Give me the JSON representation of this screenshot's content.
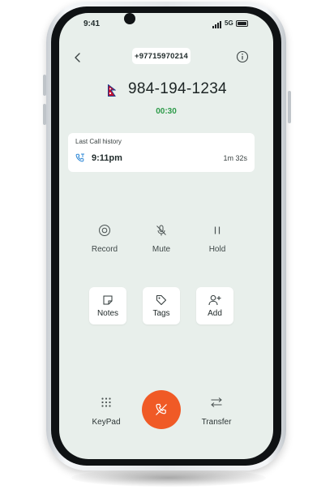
{
  "status_bar": {
    "time": "9:41",
    "network": "5G"
  },
  "header": {
    "phone_number": "+97715970214"
  },
  "call": {
    "number": "984-194-1234",
    "duration": "00:30",
    "flag": "nepal-flag"
  },
  "history": {
    "title": "Last Call history",
    "time": "9:11pm",
    "duration": "1m 32s"
  },
  "controls": {
    "record_label": "Record",
    "mute_label": "Mute",
    "hold_label": "Hold"
  },
  "actions": {
    "notes_label": "Notes",
    "tags_label": "Tags",
    "add_label": "Add"
  },
  "bottom": {
    "keypad_label": "KeyPad",
    "transfer_label": "Transfer"
  },
  "colors": {
    "screen_bg": "#e8efeb",
    "end_call": "#f05a26",
    "timer": "#2e9b4a"
  }
}
